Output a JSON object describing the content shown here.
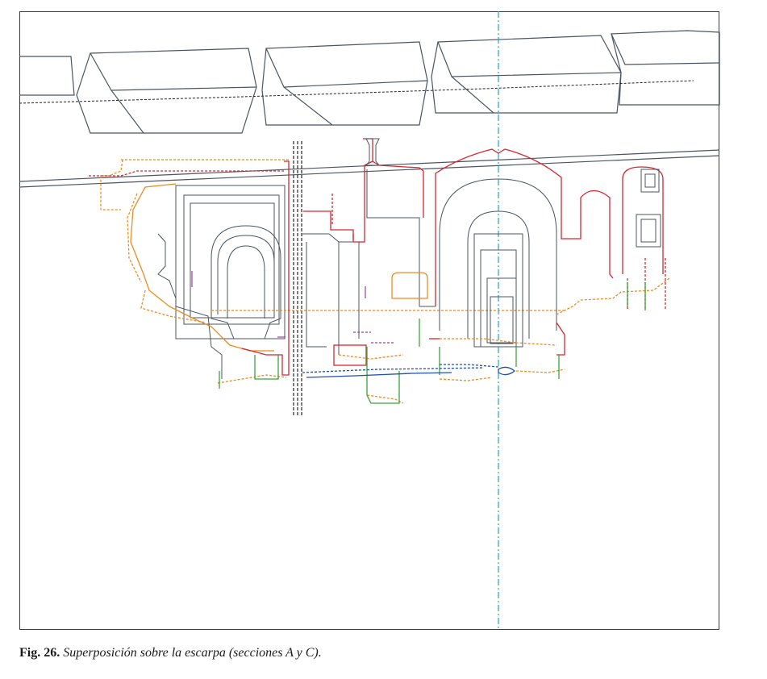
{
  "figure": {
    "caption_label": "Fig. 26.",
    "caption_text": " Superposición sobre la escarpa  (secciones A y C)."
  },
  "colors": {
    "outline": "#4a5560",
    "section_a": "#d8262e",
    "section_c": "#f08a1e",
    "axis": "#1aa7c7",
    "ground": "#3aa43a",
    "water": "#1f4fb0",
    "purple": "#9a3fa8"
  }
}
